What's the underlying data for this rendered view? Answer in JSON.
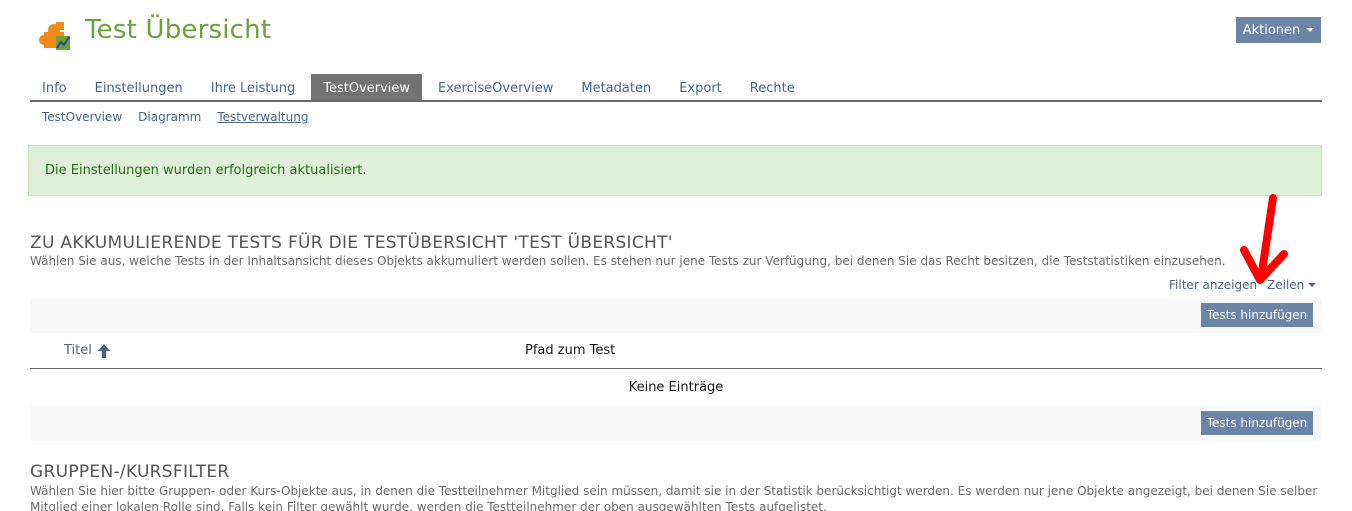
{
  "header": {
    "title": "Test Übersicht",
    "actions_label": "Aktionen"
  },
  "tabs": [
    {
      "label": "Info",
      "active": false
    },
    {
      "label": "Einstellungen",
      "active": false
    },
    {
      "label": "Ihre Leistung",
      "active": false
    },
    {
      "label": "TestOverview",
      "active": true
    },
    {
      "label": "ExerciseOverview",
      "active": false
    },
    {
      "label": "Metadaten",
      "active": false
    },
    {
      "label": "Export",
      "active": false
    },
    {
      "label": "Rechte",
      "active": false
    }
  ],
  "subtabs": [
    {
      "label": "TestOverview",
      "active": false
    },
    {
      "label": "Diagramm",
      "active": false
    },
    {
      "label": "Testverwaltung",
      "active": true
    }
  ],
  "alert": {
    "message": "Die Einstellungen wurden erfolgreich aktualisiert."
  },
  "section1": {
    "title": "ZU AKKUMULIERENDE TESTS FÜR DIE TESTÜBERSICHT 'TEST ÜBERSICHT'",
    "description": "Wählen Sie aus, welche Tests in der Inhaltsansicht dieses Objekts akkumuliert werden sollen. Es stehen nur jene Tests zur Verfügung, bei denen Sie das Recht besitzen, die Teststatistiken einzusehen."
  },
  "table": {
    "filter_link": "Filter anzeigen",
    "rows_link": "Zeilen",
    "add_button": "Tests hinzufügen",
    "columns": [
      "Titel",
      "Pfad zum Test"
    ],
    "empty_text": "Keine Einträge"
  },
  "section2": {
    "title": "GRUPPEN-/KURSFILTER",
    "description": "Wählen Sie hier bitte Gruppen- oder Kurs-Objekte aus, in denen die Testteilnehmer Mitglied sein müssen, damit sie in der Statistik berücksichtigt werden. Es werden nur jene Objekte angezeigt, bei denen Sie selber Mitglied einer lokalen Rolle sind. Falls kein Filter gewählt wurde, werden die Testteilnehmer der oben ausgewählten Tests aufgelistet."
  },
  "colors": {
    "title_green": "#6ea03c",
    "link_blue": "#4c6586",
    "button_blue": "#6b85a6",
    "alert_bg": "#dff0d8",
    "annotation_red": "#ff0000"
  }
}
